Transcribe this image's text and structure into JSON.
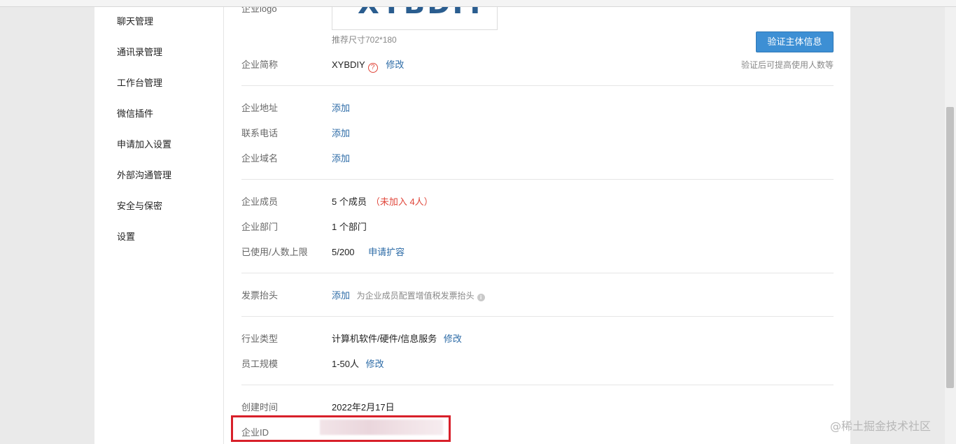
{
  "sidebar": {
    "items": [
      {
        "label": "聊天管理"
      },
      {
        "label": "通讯录管理"
      },
      {
        "label": "工作台管理"
      },
      {
        "label": "微信插件"
      },
      {
        "label": "申请加入设置"
      },
      {
        "label": "外部沟通管理"
      },
      {
        "label": "安全与保密"
      },
      {
        "label": "设置"
      }
    ]
  },
  "logo": {
    "label": "企业logo",
    "text": "XYBDIY",
    "size_hint": "推荐尺寸702*180"
  },
  "verify": {
    "button": "验证主体信息",
    "hint": "验证后可提高使用人数等"
  },
  "short_name": {
    "label": "企业简称",
    "value": "XYBDIY",
    "help_glyph": "?",
    "edit": "修改"
  },
  "contact": {
    "address_label": "企业地址",
    "address_action": "添加",
    "phone_label": "联系电话",
    "phone_action": "添加",
    "domain_label": "企业域名",
    "domain_action": "添加"
  },
  "members": {
    "label": "企业成员",
    "value": "5 个成员",
    "unjoined": "（未加入 4人）",
    "dept_label": "企业部门",
    "dept_value": "1 个部门",
    "limit_label": "已使用/人数上限",
    "limit_value": "5/200",
    "expand": "申请扩容"
  },
  "invoice": {
    "label": "发票抬头",
    "action": "添加",
    "hint": "为企业成员配置增值税发票抬头",
    "info_glyph": "i"
  },
  "industry": {
    "label": "行业类型",
    "value": "计算机软件/硬件/信息服务",
    "edit": "修改",
    "scale_label": "员工规模",
    "scale_value": "1-50人",
    "scale_edit": "修改"
  },
  "meta": {
    "created_label": "创建时间",
    "created_value": "2022年2月17日",
    "id_label": "企业ID"
  },
  "watermark": "@稀土掘金技术社区",
  "colors": {
    "link": "#2b6aa6",
    "accent_button": "#3d8fd4",
    "warning": "#e0463a",
    "highlight_box": "#d8202a"
  }
}
